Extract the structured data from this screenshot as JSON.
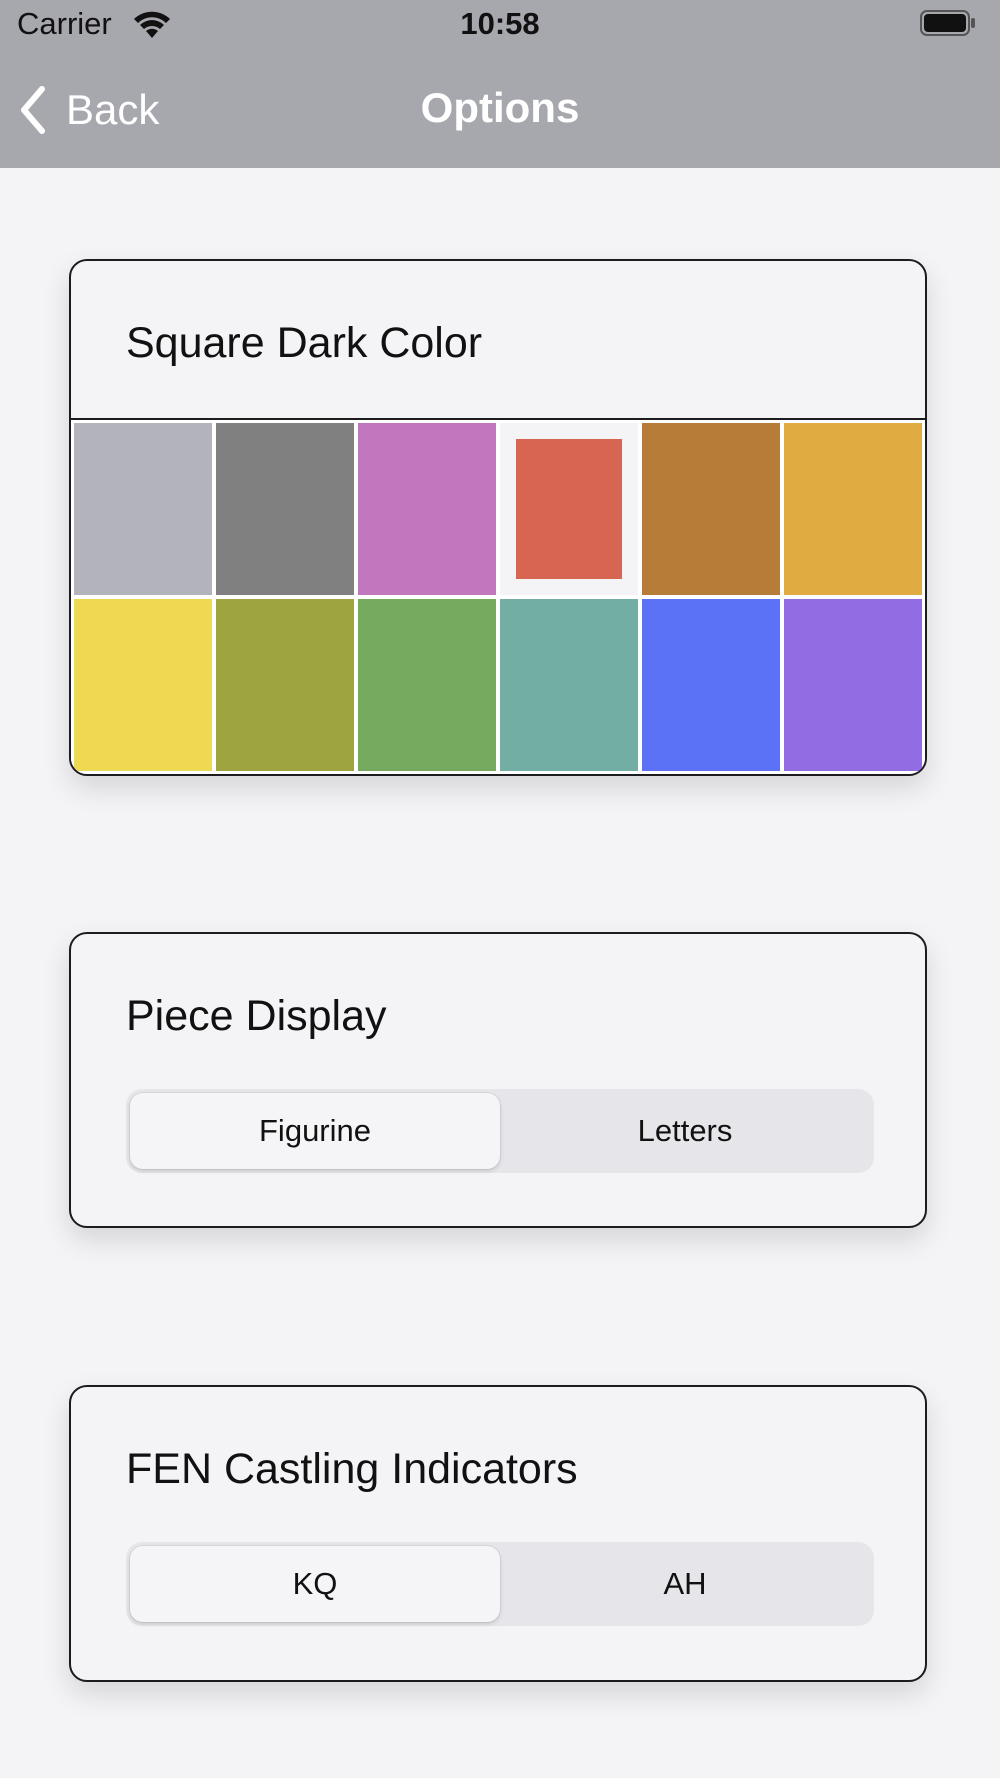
{
  "status_bar": {
    "carrier": "Carrier",
    "time": "10:58",
    "wifi_icon": "wifi-icon",
    "battery_icon": "battery-icon"
  },
  "nav": {
    "back_label": "Back",
    "back_icon": "chevron-left-icon",
    "title": "Options"
  },
  "square_dark_color": {
    "title": "Square Dark Color",
    "selected_index": 3,
    "swatches": [
      {
        "color": "#b3b3bb"
      },
      {
        "color": "#808080"
      },
      {
        "color": "#c077bd"
      },
      {
        "color": "#d66552"
      },
      {
        "color": "#b77d38"
      },
      {
        "color": "#e0ab41"
      },
      {
        "color": "#efd953"
      },
      {
        "color": "#9ea440"
      },
      {
        "color": "#76aa5e"
      },
      {
        "color": "#73aea5"
      },
      {
        "color": "#5b71f6"
      },
      {
        "color": "#926ce2"
      }
    ]
  },
  "piece_display": {
    "title": "Piece Display",
    "options": [
      "Figurine",
      "Letters"
    ],
    "selected": "Figurine"
  },
  "fen_castling": {
    "title": "FEN Castling Indicators",
    "options": [
      "KQ",
      "AH"
    ],
    "selected": "KQ"
  },
  "colors": {
    "nav_background": "#a7a7ae",
    "page_background": "#f4f4f7",
    "segmented_track": "#e6e6ea"
  }
}
